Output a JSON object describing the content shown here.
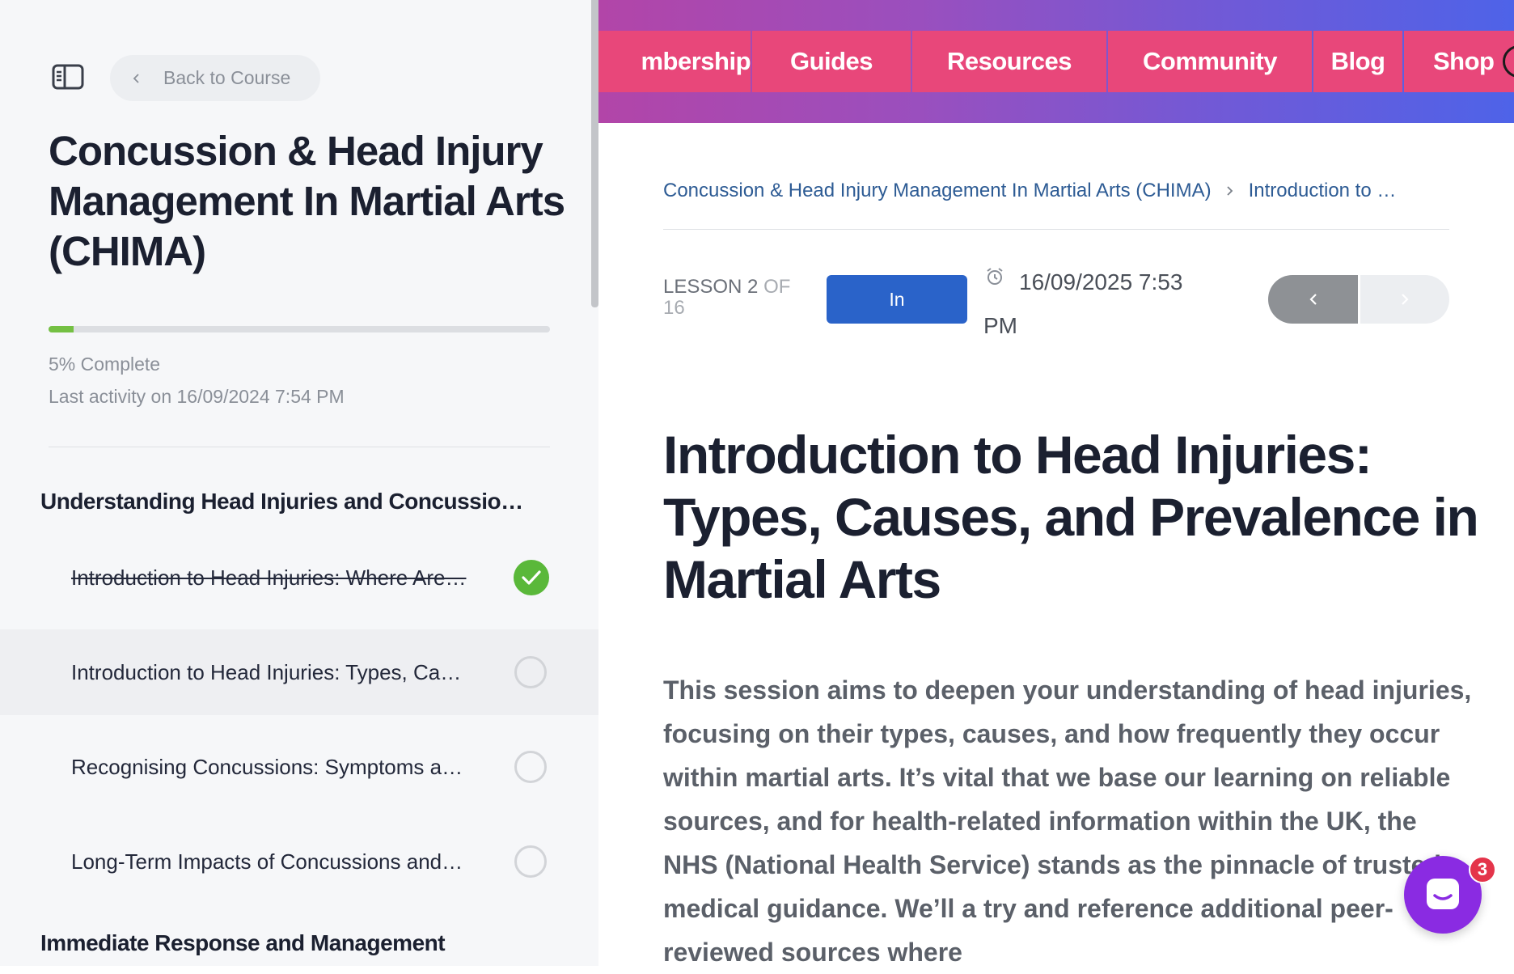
{
  "sidebar": {
    "back_label": "Back to Course",
    "course_title": "Concussion & Head Injury Management In Martial Arts (CHIMA)",
    "progress_percent": 5,
    "progress_label": "5% Complete",
    "last_activity": "Last activity on 16/09/2024 7:54 PM",
    "sections": [
      {
        "title": "Understanding Head Injuries and Concussio…",
        "lessons": [
          {
            "label": "Introduction to Head Injuries: Where Are…",
            "status": "complete"
          },
          {
            "label": "Introduction to Head Injuries: Types, Ca…",
            "status": "current"
          },
          {
            "label": "Recognising Concussions: Symptoms a…",
            "status": "incomplete"
          },
          {
            "label": "Long-Term Impacts of Concussions and…",
            "status": "incomplete"
          }
        ]
      },
      {
        "title": "Immediate Response and Management"
      }
    ]
  },
  "topnav": {
    "items": [
      "mbership",
      "Guides",
      "Resources",
      "Community",
      "Blog",
      "Shop"
    ]
  },
  "main": {
    "breadcrumb": [
      "Concussion & Head Injury Management In Martial Arts (CHIMA)",
      "Introduction to …"
    ],
    "lesson_of_label": "LESSON 2",
    "lesson_of_rest": "OF",
    "lesson_total": "16",
    "status_button": "In",
    "date": "16/09/2025 7:53 PM",
    "lesson_title": "Introduction to Head Injuries: Types, Causes, and Prevalence in Martial Arts",
    "body": "This session aims to deepen your understanding of head injuries, focusing on their types, causes, and how frequently they occur within martial arts. It’s vital that we base our learning on reliable sources, and for health-related information within the UK, the NHS (National Health Service) stands as the pinnacle of trusted medical guidance. We’ll a try and reference additional peer-reviewed sources where"
  },
  "chat": {
    "badge_count": "3"
  },
  "colors": {
    "nav_item": "#e8477a",
    "progress": "#74c043",
    "check": "#5ab83a",
    "primary_button": "#2a63c9",
    "chat": "#8a2be2"
  }
}
